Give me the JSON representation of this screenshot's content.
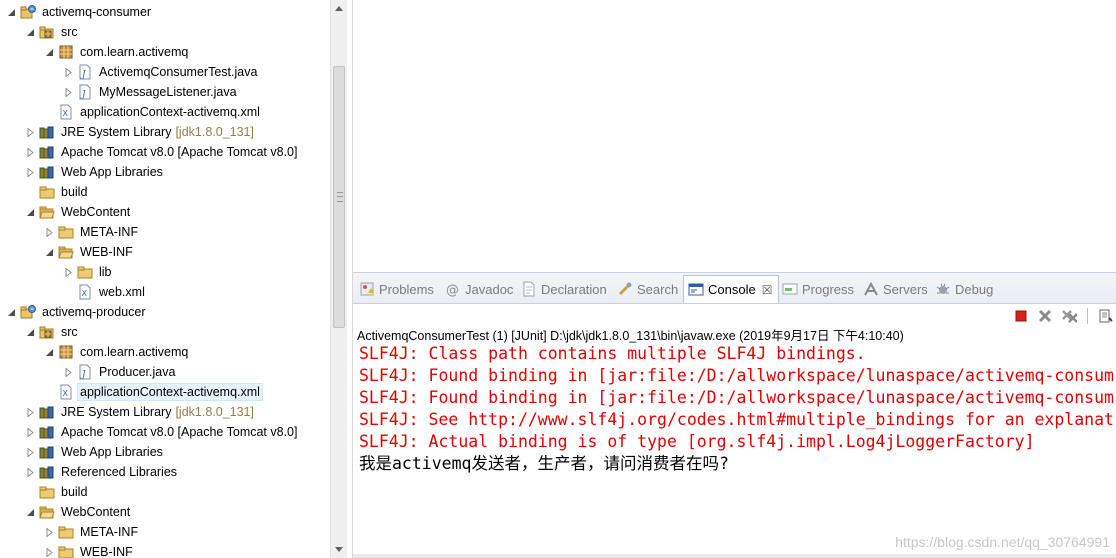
{
  "explorer": {
    "rows": [
      {
        "label": "activemq-consumer",
        "decor": "",
        "twisty": "open",
        "icon": "project-icon"
      },
      {
        "label": "src",
        "decor": "",
        "twisty": "open",
        "icon": "source-folder-icon"
      },
      {
        "label": "com.learn.activemq",
        "decor": "",
        "twisty": "open",
        "icon": "package-icon"
      },
      {
        "label": "ActivemqConsumerTest.java",
        "decor": "",
        "twisty": "closed",
        "icon": "java-file-icon"
      },
      {
        "label": "MyMessageListener.java",
        "decor": "",
        "twisty": "closed",
        "icon": "java-file-icon"
      },
      {
        "label": "applicationContext-activemq.xml",
        "decor": "",
        "twisty": "none",
        "icon": "xml-file-icon"
      },
      {
        "label": "JRE System Library",
        "decor": "[jdk1.8.0_131]",
        "twisty": "closed",
        "icon": "library-icon"
      },
      {
        "label": "Apache Tomcat v8.0 [Apache Tomcat v8.0]",
        "decor": "",
        "twisty": "closed",
        "icon": "library-icon"
      },
      {
        "label": "Web App Libraries",
        "decor": "",
        "twisty": "closed",
        "icon": "library-icon"
      },
      {
        "label": "build",
        "decor": "",
        "twisty": "none",
        "icon": "folder-icon"
      },
      {
        "label": "WebContent",
        "decor": "",
        "twisty": "open",
        "icon": "folder-open-icon"
      },
      {
        "label": "META-INF",
        "decor": "",
        "twisty": "closed",
        "icon": "folder-icon"
      },
      {
        "label": "WEB-INF",
        "decor": "",
        "twisty": "open",
        "icon": "folder-open-icon"
      },
      {
        "label": "lib",
        "decor": "",
        "twisty": "closed",
        "icon": "folder-icon"
      },
      {
        "label": "web.xml",
        "decor": "",
        "twisty": "none",
        "icon": "xml-file-icon"
      },
      {
        "label": "activemq-producer",
        "decor": "",
        "twisty": "open",
        "icon": "project-icon"
      },
      {
        "label": "src",
        "decor": "",
        "twisty": "open",
        "icon": "source-folder-icon"
      },
      {
        "label": "com.learn.activemq",
        "decor": "",
        "twisty": "open",
        "icon": "package-icon"
      },
      {
        "label": "Producer.java",
        "decor": "",
        "twisty": "closed",
        "icon": "java-file-icon"
      },
      {
        "label": "applicationContext-activemq.xml",
        "decor": "",
        "twisty": "none",
        "icon": "xml-file-icon",
        "selected": true
      },
      {
        "label": "JRE System Library",
        "decor": "[jdk1.8.0_131]",
        "twisty": "closed",
        "icon": "library-icon"
      },
      {
        "label": "Apache Tomcat v8.0 [Apache Tomcat v8.0]",
        "decor": "",
        "twisty": "closed",
        "icon": "library-icon"
      },
      {
        "label": "Web App Libraries",
        "decor": "",
        "twisty": "closed",
        "icon": "library-icon"
      },
      {
        "label": "Referenced Libraries",
        "decor": "",
        "twisty": "closed",
        "icon": "library-icon"
      },
      {
        "label": "build",
        "decor": "",
        "twisty": "none",
        "icon": "folder-icon"
      },
      {
        "label": "WebContent",
        "decor": "",
        "twisty": "open",
        "icon": "folder-open-icon"
      },
      {
        "label": "META-INF",
        "decor": "",
        "twisty": "closed",
        "icon": "folder-icon"
      },
      {
        "label": "WEB-INF",
        "decor": "",
        "twisty": "closed",
        "icon": "folder-icon"
      }
    ]
  },
  "views": {
    "tabs": [
      {
        "label": "Problems",
        "icon": "problems-icon",
        "active": false
      },
      {
        "label": "Javadoc",
        "icon": "javadoc-icon",
        "active": false
      },
      {
        "label": "Declaration",
        "icon": "declaration-icon",
        "active": false
      },
      {
        "label": "Search",
        "icon": "search-icon",
        "active": false
      },
      {
        "label": "Console",
        "icon": "console-icon",
        "active": true
      },
      {
        "label": "Progress",
        "icon": "progress-icon",
        "active": false
      },
      {
        "label": "Servers",
        "icon": "servers-icon",
        "active": false
      },
      {
        "label": "Debug",
        "icon": "debug-icon",
        "active": false
      }
    ],
    "close_glyph": "☒"
  },
  "console": {
    "launch_info": "ActivemqConsumerTest (1) [JUnit] D:\\jdk\\jdk1.8.0_131\\bin\\javaw.exe (2019年9月17日 下午4:10:40)",
    "lines": [
      {
        "text": "SLF4J: Class path contains multiple SLF4J bindings.",
        "kind": "err"
      },
      {
        "text": "SLF4J: Found binding in [jar:file:/D:/allworkspace/lunaspace/activemq-consum",
        "kind": "err"
      },
      {
        "text": "SLF4J: Found binding in [jar:file:/D:/allworkspace/lunaspace/activemq-consum",
        "kind": "err"
      },
      {
        "text": "SLF4J: See http://www.slf4j.org/codes.html#multiple_bindings for an explanat",
        "kind": "err"
      },
      {
        "text": "SLF4J: Actual binding is of type [org.slf4j.impl.Log4jLoggerFactory]",
        "kind": "err"
      },
      {
        "text": "我是activemq发送者，生产者，请问消费者在吗?",
        "kind": "out"
      }
    ],
    "colors": {
      "stderr": "#e00000",
      "stdout": "#000000",
      "terminate": "#d62020"
    }
  },
  "watermark": "https://blog.csdn.net/qq_30764991"
}
